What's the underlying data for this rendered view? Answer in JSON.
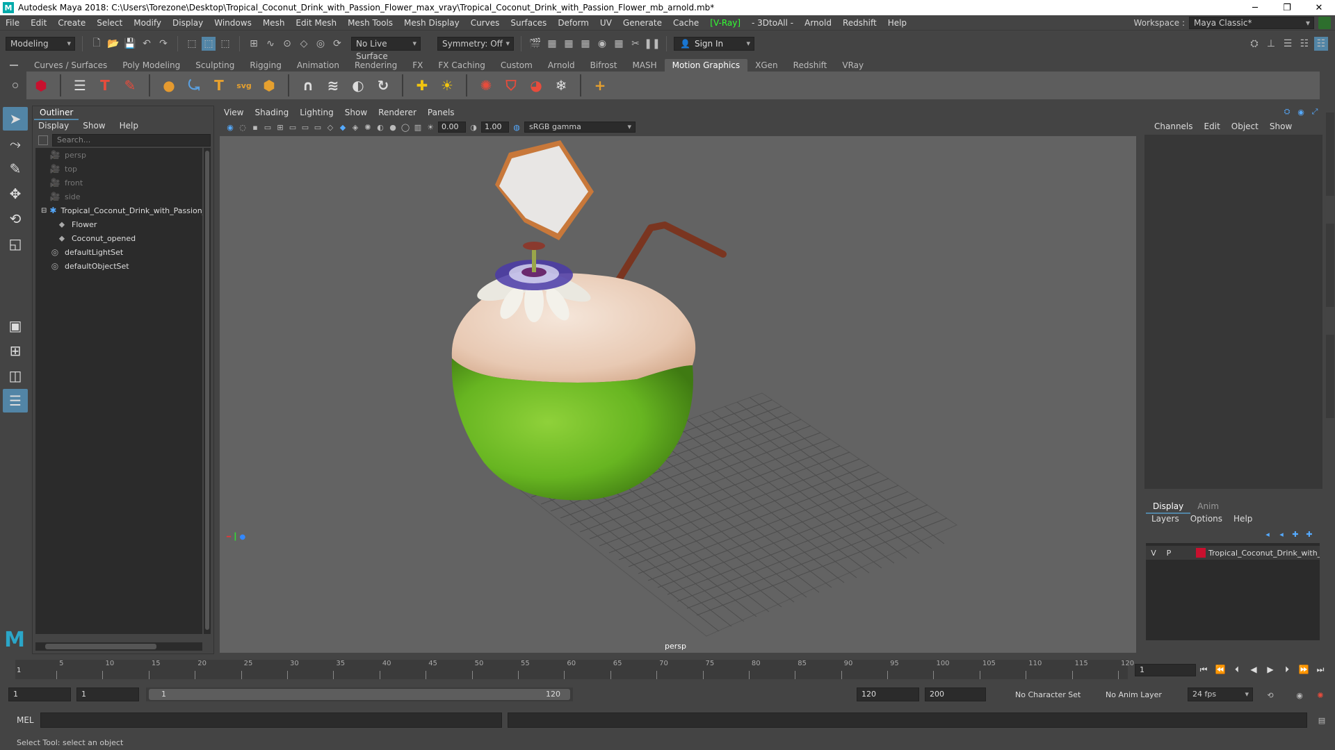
{
  "window": {
    "title": "Autodesk Maya 2018: C:\\Users\\Torezone\\Desktop\\Tropical_Coconut_Drink_with_Passion_Flower_max_vray\\Tropical_Coconut_Drink_with_Passion_Flower_mb_arnold.mb*"
  },
  "menus": [
    "File",
    "Edit",
    "Create",
    "Select",
    "Modify",
    "Display",
    "Windows",
    "Mesh",
    "Edit Mesh",
    "Mesh Tools",
    "Mesh Display",
    "Curves",
    "Surfaces",
    "Deform",
    "UV",
    "Generate",
    "Cache"
  ],
  "menus_after": [
    "- 3DtoAll -",
    "Arnold",
    "Redshift",
    "Help"
  ],
  "vray_menu": "[V-Ray]",
  "workspace": {
    "label": "Workspace :",
    "value": "Maya Classic*"
  },
  "statusline": {
    "mode": "Modeling",
    "live_surface": "No Live Surface",
    "symmetry": "Symmetry: Off",
    "sign_in": "Sign In"
  },
  "shelf_tabs": [
    "Curves / Surfaces",
    "Poly Modeling",
    "Sculpting",
    "Rigging",
    "Animation",
    "Rendering",
    "FX",
    "FX Caching",
    "Custom",
    "Arnold",
    "Bifrost",
    "MASH",
    "Motion Graphics",
    "XGen",
    "Redshift",
    "VRay"
  ],
  "active_shelf": "Motion Graphics",
  "outliner": {
    "tab": "Outliner",
    "menu": [
      "Display",
      "Show",
      "Help"
    ],
    "search_placeholder": "Search...",
    "items": [
      {
        "label": "persp",
        "dim": true
      },
      {
        "label": "top",
        "dim": true
      },
      {
        "label": "front",
        "dim": true
      },
      {
        "label": "side",
        "dim": true
      },
      {
        "label": "Tropical_Coconut_Drink_with_Passion_Flower",
        "dim": false
      },
      {
        "label": "Flower",
        "dim": false
      },
      {
        "label": "Coconut_opened",
        "dim": false
      },
      {
        "label": "defaultLightSet",
        "dim": false
      },
      {
        "label": "defaultObjectSet",
        "dim": false
      }
    ]
  },
  "viewport": {
    "menu": [
      "View",
      "Shading",
      "Lighting",
      "Show",
      "Renderer",
      "Panels"
    ],
    "exposure": "0.00",
    "gamma": "1.00",
    "color_space": "sRGB gamma",
    "camera": "persp"
  },
  "channelbox": {
    "menu": [
      "Channels",
      "Edit",
      "Object",
      "Show"
    ],
    "layer_tabs": [
      "Display",
      "Anim"
    ],
    "layer_menu": [
      "Layers",
      "Options",
      "Help"
    ],
    "layer": {
      "v": "V",
      "p": "P",
      "name": "Tropical_Coconut_Drink_with_Passion_Flower",
      "color": "#c8102e"
    }
  },
  "timeline": {
    "ticks": [
      "5",
      "10",
      "15",
      "20",
      "25",
      "30",
      "35",
      "40",
      "45",
      "50",
      "55",
      "60",
      "65",
      "70",
      "75",
      "80",
      "85",
      "90",
      "95",
      "100",
      "105",
      "110",
      "115",
      "120"
    ],
    "start_label": "1",
    "current_frame": "1"
  },
  "range": {
    "start": "1",
    "anim_start": "1",
    "slider_start": "1",
    "slider_end": "120",
    "anim_end": "120",
    "end": "200",
    "character_set": "No Character Set",
    "anim_layer": "No Anim Layer",
    "fps": "24 fps"
  },
  "cmd": {
    "lang": "MEL"
  },
  "help": {
    "text": "Select Tool: select an object"
  }
}
